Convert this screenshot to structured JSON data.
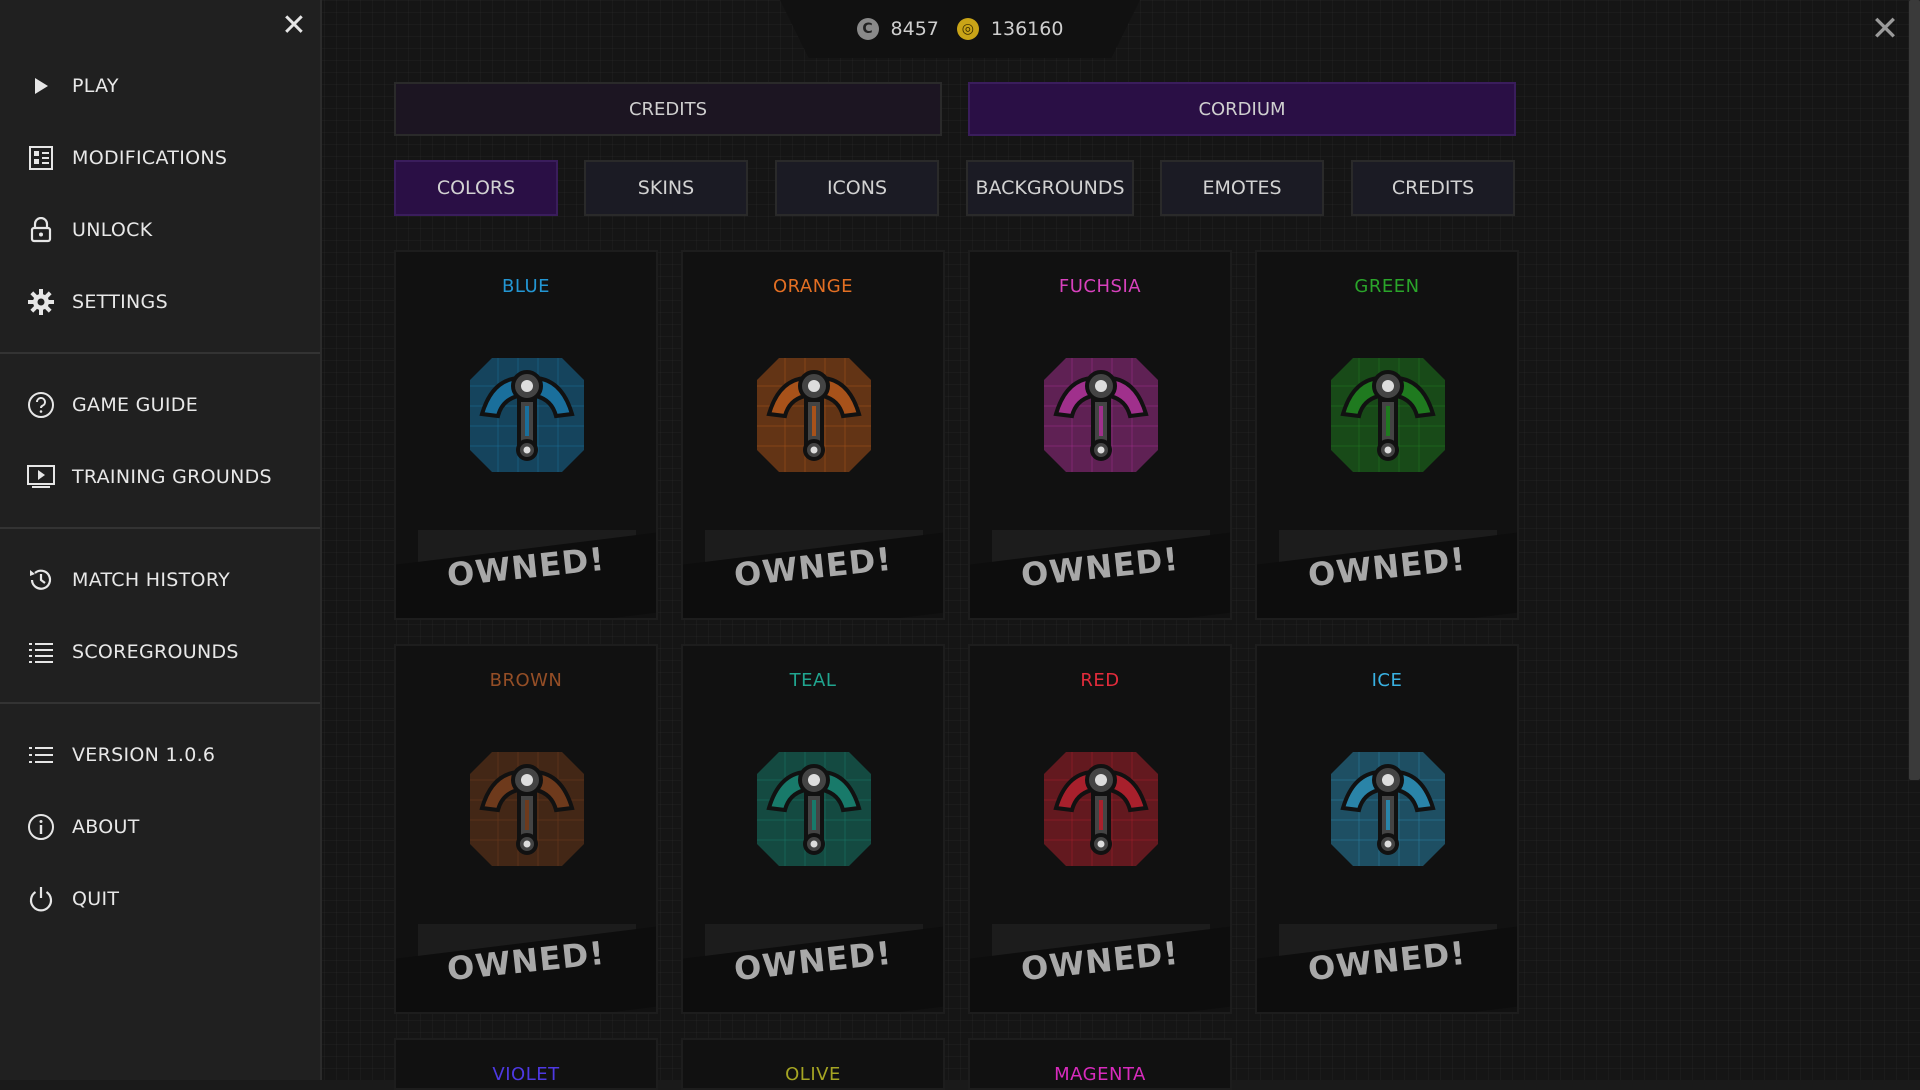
{
  "sidebar": {
    "top_items": [
      {
        "label": "PLAY",
        "icon": "play-icon"
      },
      {
        "label": "MODIFICATIONS",
        "icon": "modifications-icon"
      },
      {
        "label": "UNLOCK",
        "icon": "lock-icon"
      },
      {
        "label": "SETTINGS",
        "icon": "gear-icon"
      }
    ],
    "mid_items": [
      {
        "label": "GAME GUIDE",
        "icon": "help-icon"
      },
      {
        "label": "TRAINING GROUNDS",
        "icon": "training-icon"
      }
    ],
    "history_items": [
      {
        "label": "MATCH HISTORY",
        "icon": "history-icon"
      },
      {
        "label": "SCOREGROUNDS",
        "icon": "list-icon"
      }
    ],
    "bottom_items": [
      {
        "label": "VERSION 1.0.6",
        "icon": "list-icon"
      },
      {
        "label": "ABOUT",
        "icon": "info-icon"
      },
      {
        "label": "QUIT",
        "icon": "power-icon"
      }
    ]
  },
  "currency": {
    "credits_value": "8457",
    "cordium_value": "136160"
  },
  "currency_tabs": {
    "credits": "CREDITS",
    "cordium": "CORDIUM",
    "active": "cordium"
  },
  "category_tabs": [
    "COLORS",
    "SKINS",
    "ICONS",
    "BACKGROUNDS",
    "EMOTES",
    "CREDITS"
  ],
  "active_category": "COLORS",
  "items": [
    {
      "name": "BLUE",
      "color": "#1a6f9c",
      "status": "OWNED!"
    },
    {
      "name": "ORANGE",
      "color": "#a8521a",
      "status": "OWNED!"
    },
    {
      "name": "FUCHSIA",
      "color": "#a0308c",
      "status": "OWNED!"
    },
    {
      "name": "GREEN",
      "color": "#1f7a1f",
      "status": "OWNED!"
    },
    {
      "name": "BROWN",
      "color": "#6e3a1c",
      "status": "OWNED!"
    },
    {
      "name": "TEAL",
      "color": "#187a6a",
      "status": "OWNED!"
    },
    {
      "name": "RED",
      "color": "#a8202c",
      "status": "OWNED!"
    },
    {
      "name": "ICE",
      "color": "#2a84a8",
      "status": "OWNED!"
    },
    {
      "name": "VIOLET",
      "color": "#3a2aa8"
    },
    {
      "name": "OLIVE",
      "color": "#7a7a1a"
    },
    {
      "name": "MAGENTA",
      "color": "#a0208c"
    }
  ],
  "colors": {
    "accent_purple": "#2a0f45",
    "sidebar_bg": "#202020"
  }
}
